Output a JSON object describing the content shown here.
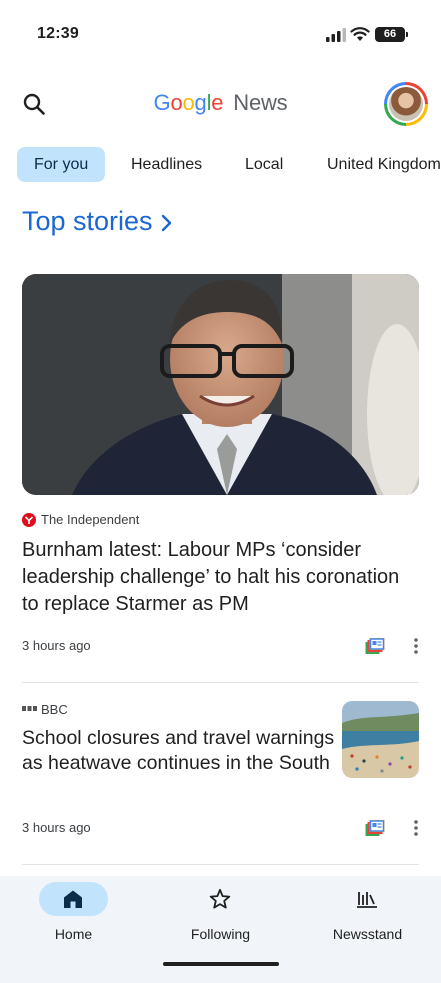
{
  "status_bar": {
    "time": "12:39",
    "battery": "66"
  },
  "header": {
    "logo_letters": [
      {
        "char": "G",
        "color": "#4285f4"
      },
      {
        "char": "o",
        "color": "#ea4335"
      },
      {
        "char": "o",
        "color": "#fbbc05"
      },
      {
        "char": "g",
        "color": "#4285f4"
      },
      {
        "char": "l",
        "color": "#34a853"
      },
      {
        "char": "e",
        "color": "#ea4335"
      }
    ],
    "logo_suffix": "News"
  },
  "tabs": [
    {
      "label": "For you",
      "active": true
    },
    {
      "label": "Headlines",
      "active": false
    },
    {
      "label": "Local",
      "active": false
    },
    {
      "label": "United Kingdom",
      "active": false
    }
  ],
  "section": {
    "title": "Top stories"
  },
  "stories": [
    {
      "source": "The Independent",
      "headline": "Burnham latest: Labour MPs ‘consider leadership challenge’ to halt his coronation to replace Starmer as PM",
      "time": "3 hours ago"
    },
    {
      "source": "BBC",
      "headline": "School closures and travel warnings as heatwave continues in the South",
      "time": "3 hours ago"
    }
  ],
  "bottom_nav": [
    {
      "label": "Home",
      "icon": "home-icon",
      "active": true
    },
    {
      "label": "Following",
      "icon": "star-icon",
      "active": false
    },
    {
      "label": "Newsstand",
      "icon": "newsstand-icon",
      "active": false
    }
  ],
  "colors": {
    "accent": "#1a66d2",
    "chip_active": "#c2e3fc",
    "nav_bg": "#f1f4f9"
  }
}
